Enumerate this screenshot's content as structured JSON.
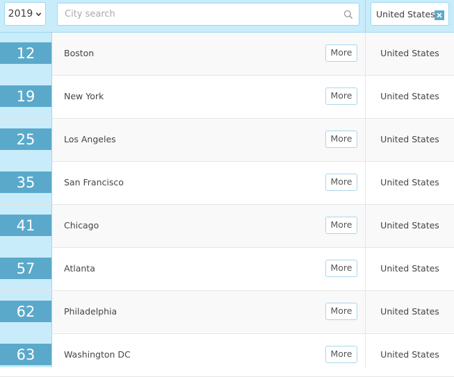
{
  "filters": {
    "year": "2019",
    "search_placeholder": "City search",
    "country": "United States"
  },
  "rows": [
    {
      "rank": "12",
      "city": "Boston",
      "more": "More",
      "country": "United States"
    },
    {
      "rank": "19",
      "city": "New York",
      "more": "More",
      "country": "United States"
    },
    {
      "rank": "25",
      "city": "Los Angeles",
      "more": "More",
      "country": "United States"
    },
    {
      "rank": "35",
      "city": "San Francisco",
      "more": "More",
      "country": "United States"
    },
    {
      "rank": "41",
      "city": "Chicago",
      "more": "More",
      "country": "United States"
    },
    {
      "rank": "57",
      "city": "Atlanta",
      "more": "More",
      "country": "United States"
    },
    {
      "rank": "62",
      "city": "Philadelphia",
      "more": "More",
      "country": "United States"
    },
    {
      "rank": "63",
      "city": "Washington DC",
      "more": "More",
      "country": "United States"
    }
  ],
  "colors": {
    "accent": "#5aa9cb",
    "rank_column_bg": "#c9ecfa",
    "border": "#9fd7ee"
  },
  "icons": {
    "year_dropdown": "chevron-down-icon",
    "search": "search-icon",
    "clear": "close-icon"
  }
}
